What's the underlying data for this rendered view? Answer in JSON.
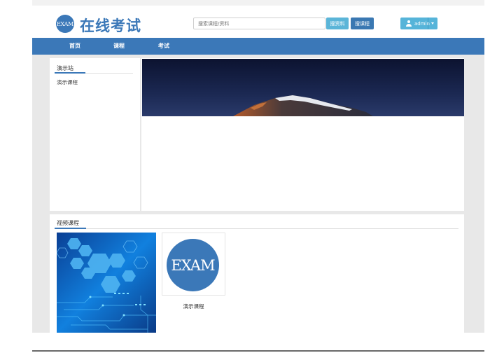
{
  "header": {
    "logo_text": "EXAM",
    "site_title": "在线考试",
    "search": {
      "placeholder": "搜索课程/资料",
      "value": ""
    },
    "search_resource_label": "搜资料",
    "search_course_label": "搜课程",
    "user": {
      "name": "admin"
    }
  },
  "nav": {
    "items": [
      {
        "label": "首页"
      },
      {
        "label": "课程"
      },
      {
        "label": "考试"
      }
    ]
  },
  "sidebar": {
    "title": "演示站",
    "items": [
      {
        "label": "演示课程"
      }
    ]
  },
  "video_section": {
    "title": "视频课程",
    "courses": [
      {
        "label": ""
      },
      {
        "label": "演示课程",
        "logo_text": "EXAM"
      }
    ]
  },
  "colors": {
    "brand": "#3b78b8",
    "search_resource_button": "#5bb5d8",
    "search_course_button": "#3a78b2",
    "user_button": "#56b4d9",
    "content_background": "#e8e8e8"
  },
  "icons": [
    "user-icon",
    "chevron-down-icon"
  ]
}
